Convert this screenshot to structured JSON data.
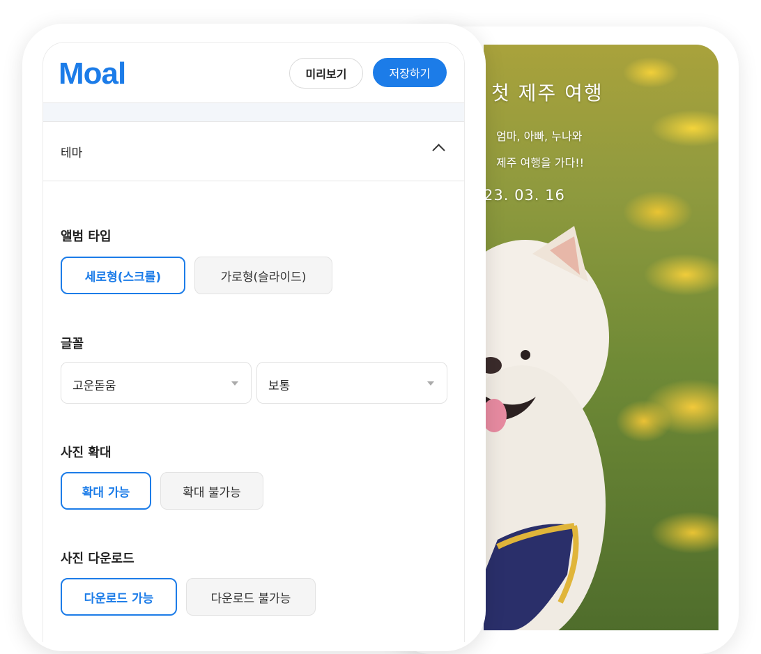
{
  "app": {
    "logo": "Moal"
  },
  "header": {
    "preview_label": "미리보기",
    "save_label": "저장하기"
  },
  "theme": {
    "label": "테마",
    "icon": "chevron-up-icon"
  },
  "album_type": {
    "label": "앨범 타입",
    "options": [
      "세로형(스크롤)",
      "가로형(슬라이드)"
    ],
    "selected": "세로형(스크롤)"
  },
  "font": {
    "label": "글꼴",
    "family": "고운돋움",
    "weight": "보통"
  },
  "zoom": {
    "label": "사진 확대",
    "options": [
      "확대 가능",
      "확대 불가능"
    ],
    "selected": "확대 가능"
  },
  "download": {
    "label": "사진 다운로드",
    "options": [
      "다운로드 가능",
      "다운로드 불가능"
    ],
    "selected": "다운로드 가능"
  },
  "preview": {
    "title": "첫 제주 여행",
    "line1": "엄마, 아빠, 누나와",
    "line2": "제주 여행을 가다!!",
    "date": "23. 03. 16"
  },
  "colors": {
    "accent": "#1c7ce8"
  }
}
